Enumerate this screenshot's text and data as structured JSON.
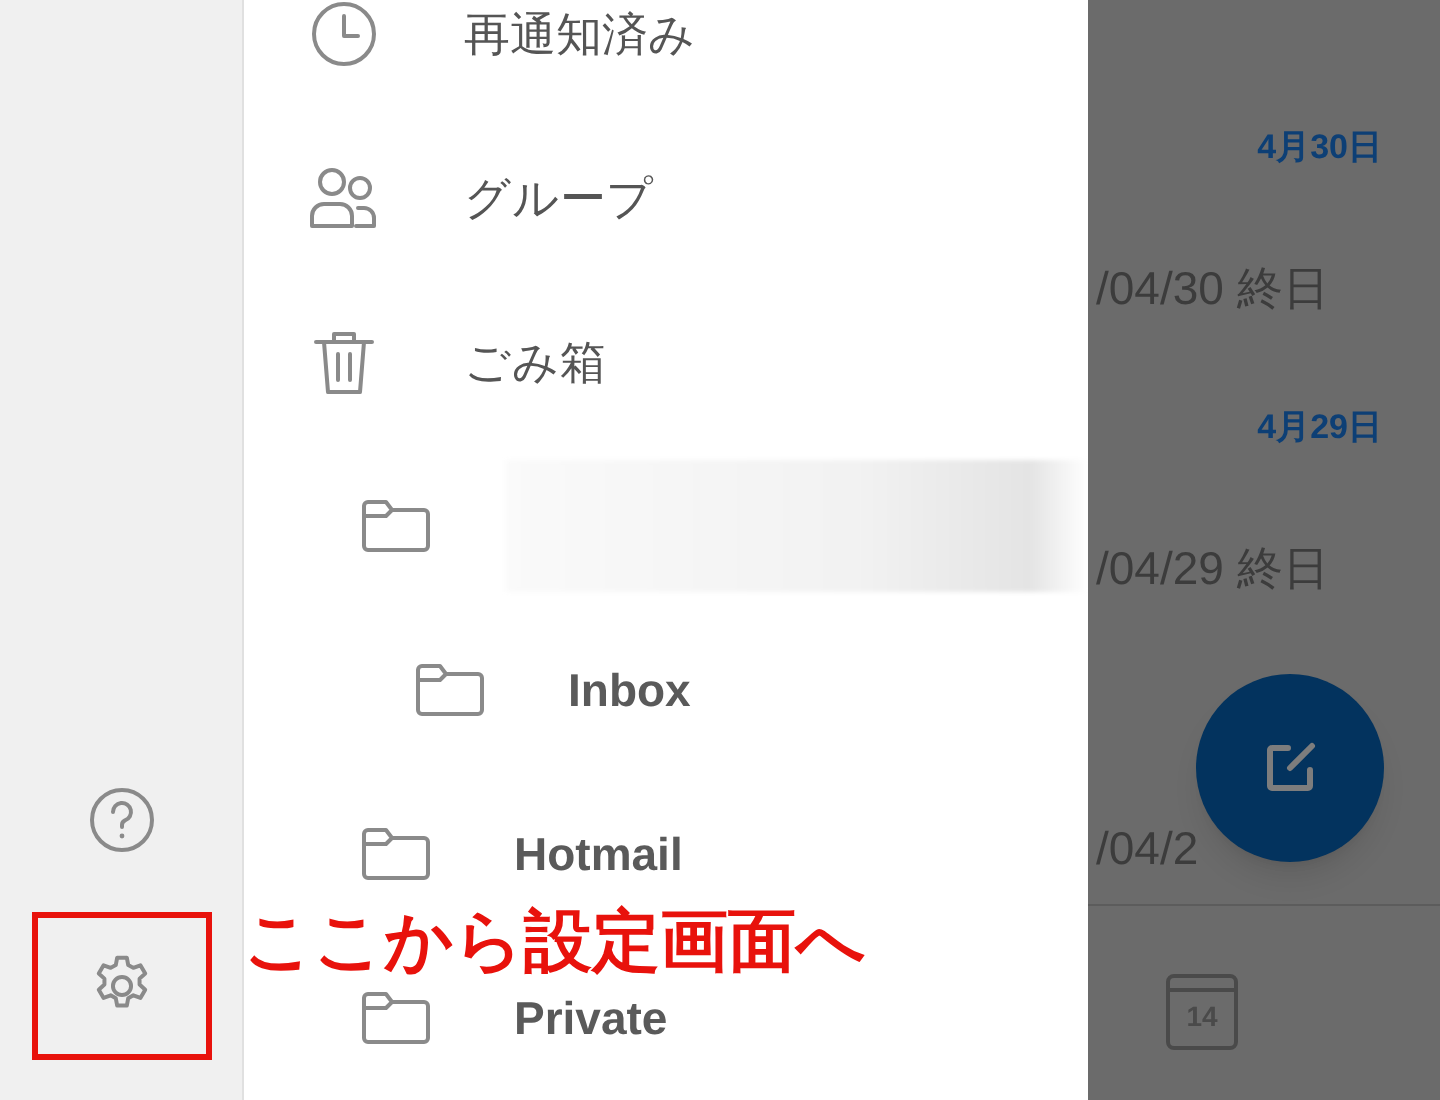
{
  "rail": {
    "settings": {
      "highlighted": true
    }
  },
  "drawer": {
    "items": [
      {
        "kind": "snoozed",
        "label": "再通知済み"
      },
      {
        "kind": "groups",
        "label": "グループ"
      },
      {
        "kind": "deleted",
        "label": "ごみ箱"
      },
      {
        "kind": "folder",
        "redacted": true,
        "children": [
          {
            "kind": "folder",
            "label": "Inbox"
          }
        ]
      },
      {
        "kind": "folder",
        "label": "Hotmail"
      },
      {
        "kind": "folder",
        "label": "Private"
      }
    ]
  },
  "agenda": {
    "entries": [
      {
        "kind": "header",
        "text": "4月30日"
      },
      {
        "kind": "event",
        "text": "/04/30 終日"
      },
      {
        "kind": "header",
        "text": "4月29日"
      },
      {
        "kind": "event",
        "text": "/04/29 終日"
      },
      {
        "kind": "event",
        "text": "/04/2"
      }
    ],
    "calendar_day": "14"
  },
  "annotation": {
    "text": "ここから設定画面へ"
  }
}
